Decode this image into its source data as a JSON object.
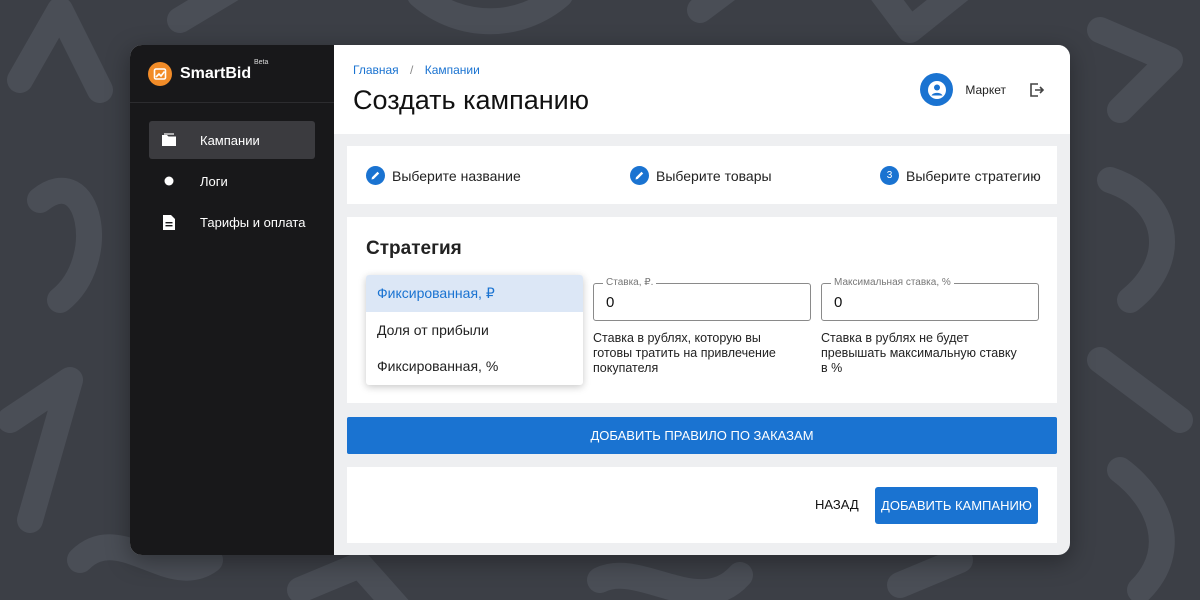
{
  "app": {
    "name": "SmartBid",
    "badge": "Beta"
  },
  "sidebar": {
    "items": [
      {
        "label": "Кампании",
        "icon": "folder-icon",
        "active": true
      },
      {
        "label": "Логи",
        "icon": "dot-icon",
        "active": false
      },
      {
        "label": "Тарифы и оплата",
        "icon": "document-icon",
        "active": false
      }
    ]
  },
  "header": {
    "breadcrumb": [
      "Главная",
      "Кампании"
    ],
    "title": "Создать кампанию",
    "user": "Маркет"
  },
  "steps": [
    {
      "label": "Выберите название",
      "icon": "pencil-icon",
      "status": "done"
    },
    {
      "label": "Выберите товары",
      "icon": "pencil-icon",
      "status": "done"
    },
    {
      "label": "Выберите стратегию",
      "number": "3",
      "status": "current"
    }
  ],
  "strategy": {
    "title": "Стратегия",
    "options": [
      "Фиксированная, ₽",
      "Доля от прибыли",
      "Фиксированная, %"
    ],
    "selected_index": 0,
    "rate": {
      "label": "Ставка, ₽.",
      "value": "0",
      "hint": "Ставка в рублях, которую вы готовы тратить на привлечение покупателя"
    },
    "max_rate": {
      "label": "Максимальная ставка, %",
      "value": "0",
      "hint": "Ставка в рублях не будет превышать максимальную ставку в %"
    }
  },
  "actions": {
    "add_rule": "ДОБАВИТЬ ПРАВИЛО ПО ЗАКАЗАМ",
    "back": "НАЗАД",
    "add_campaign": "ДОБАВИТЬ КАМПАНИЮ"
  },
  "colors": {
    "accent": "#1a73d1",
    "sidebar_bg": "#18181a",
    "brand_orange": "#f28c28",
    "page_bg": "#3c3f46"
  }
}
